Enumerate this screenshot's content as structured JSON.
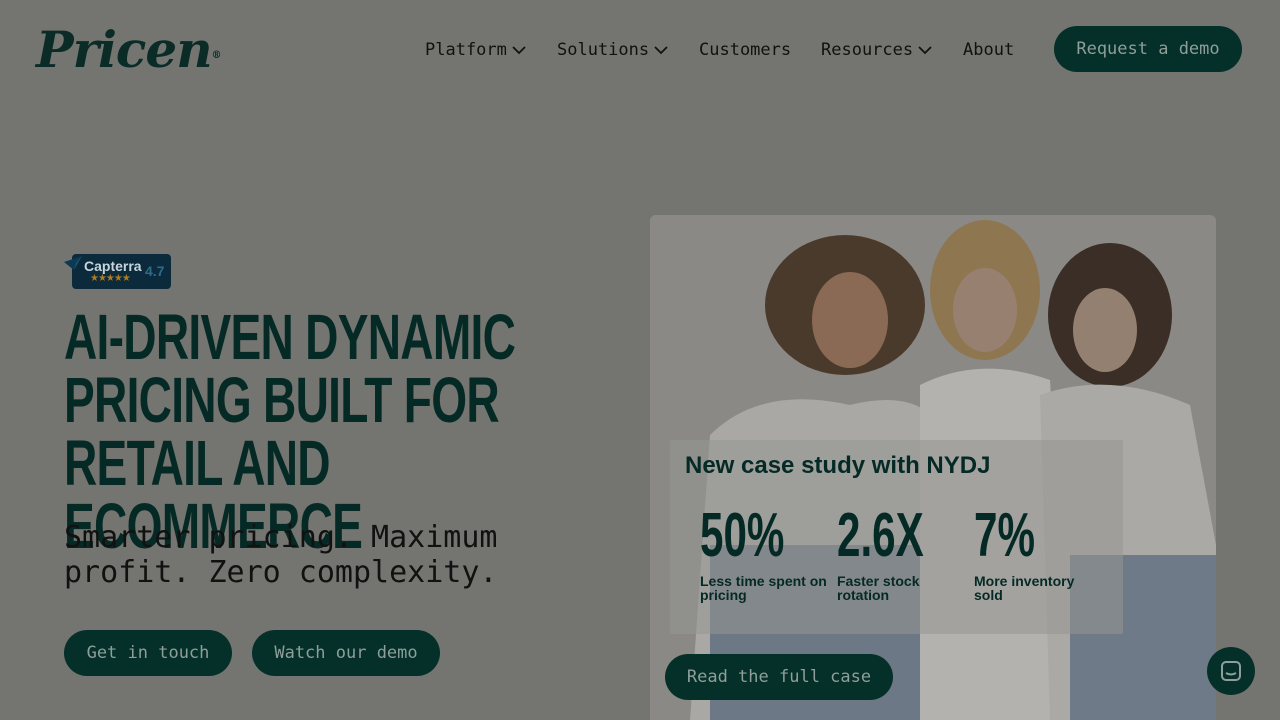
{
  "header": {
    "logo": "Pricen",
    "nav": [
      {
        "label": "Platform",
        "has_dropdown": true
      },
      {
        "label": "Solutions",
        "has_dropdown": true
      },
      {
        "label": "Customers",
        "has_dropdown": false
      },
      {
        "label": "Resources",
        "has_dropdown": true
      },
      {
        "label": "About",
        "has_dropdown": false
      }
    ],
    "cta_label": "Request a demo"
  },
  "badge": {
    "name": "Capterra",
    "stars": "★★★★★",
    "score": "4.7"
  },
  "hero": {
    "title": "AI-DRIVEN DYNAMIC PRICING BUILT FOR RETAIL AND ECOMMERCE",
    "subtitle": "Smarter pricing. Maximum profit. Zero complexity.",
    "primary_button": "Get in touch",
    "secondary_button": "Watch our demo"
  },
  "case_study": {
    "title": "New case study with NYDJ",
    "stats": [
      {
        "value": "50%",
        "label": "Less time spent on pricing"
      },
      {
        "value": "2.6X",
        "label": "Faster stock rotation"
      },
      {
        "value": "7%",
        "label": "More inventory sold"
      }
    ],
    "button": "Read the full case"
  },
  "colors": {
    "overlay_bg": "#747470",
    "brand_dark": "#05302a",
    "button_text": "#8e9e99"
  },
  "icons": {
    "chat": "chat-icon",
    "dropdown": "chevron-down-icon"
  }
}
